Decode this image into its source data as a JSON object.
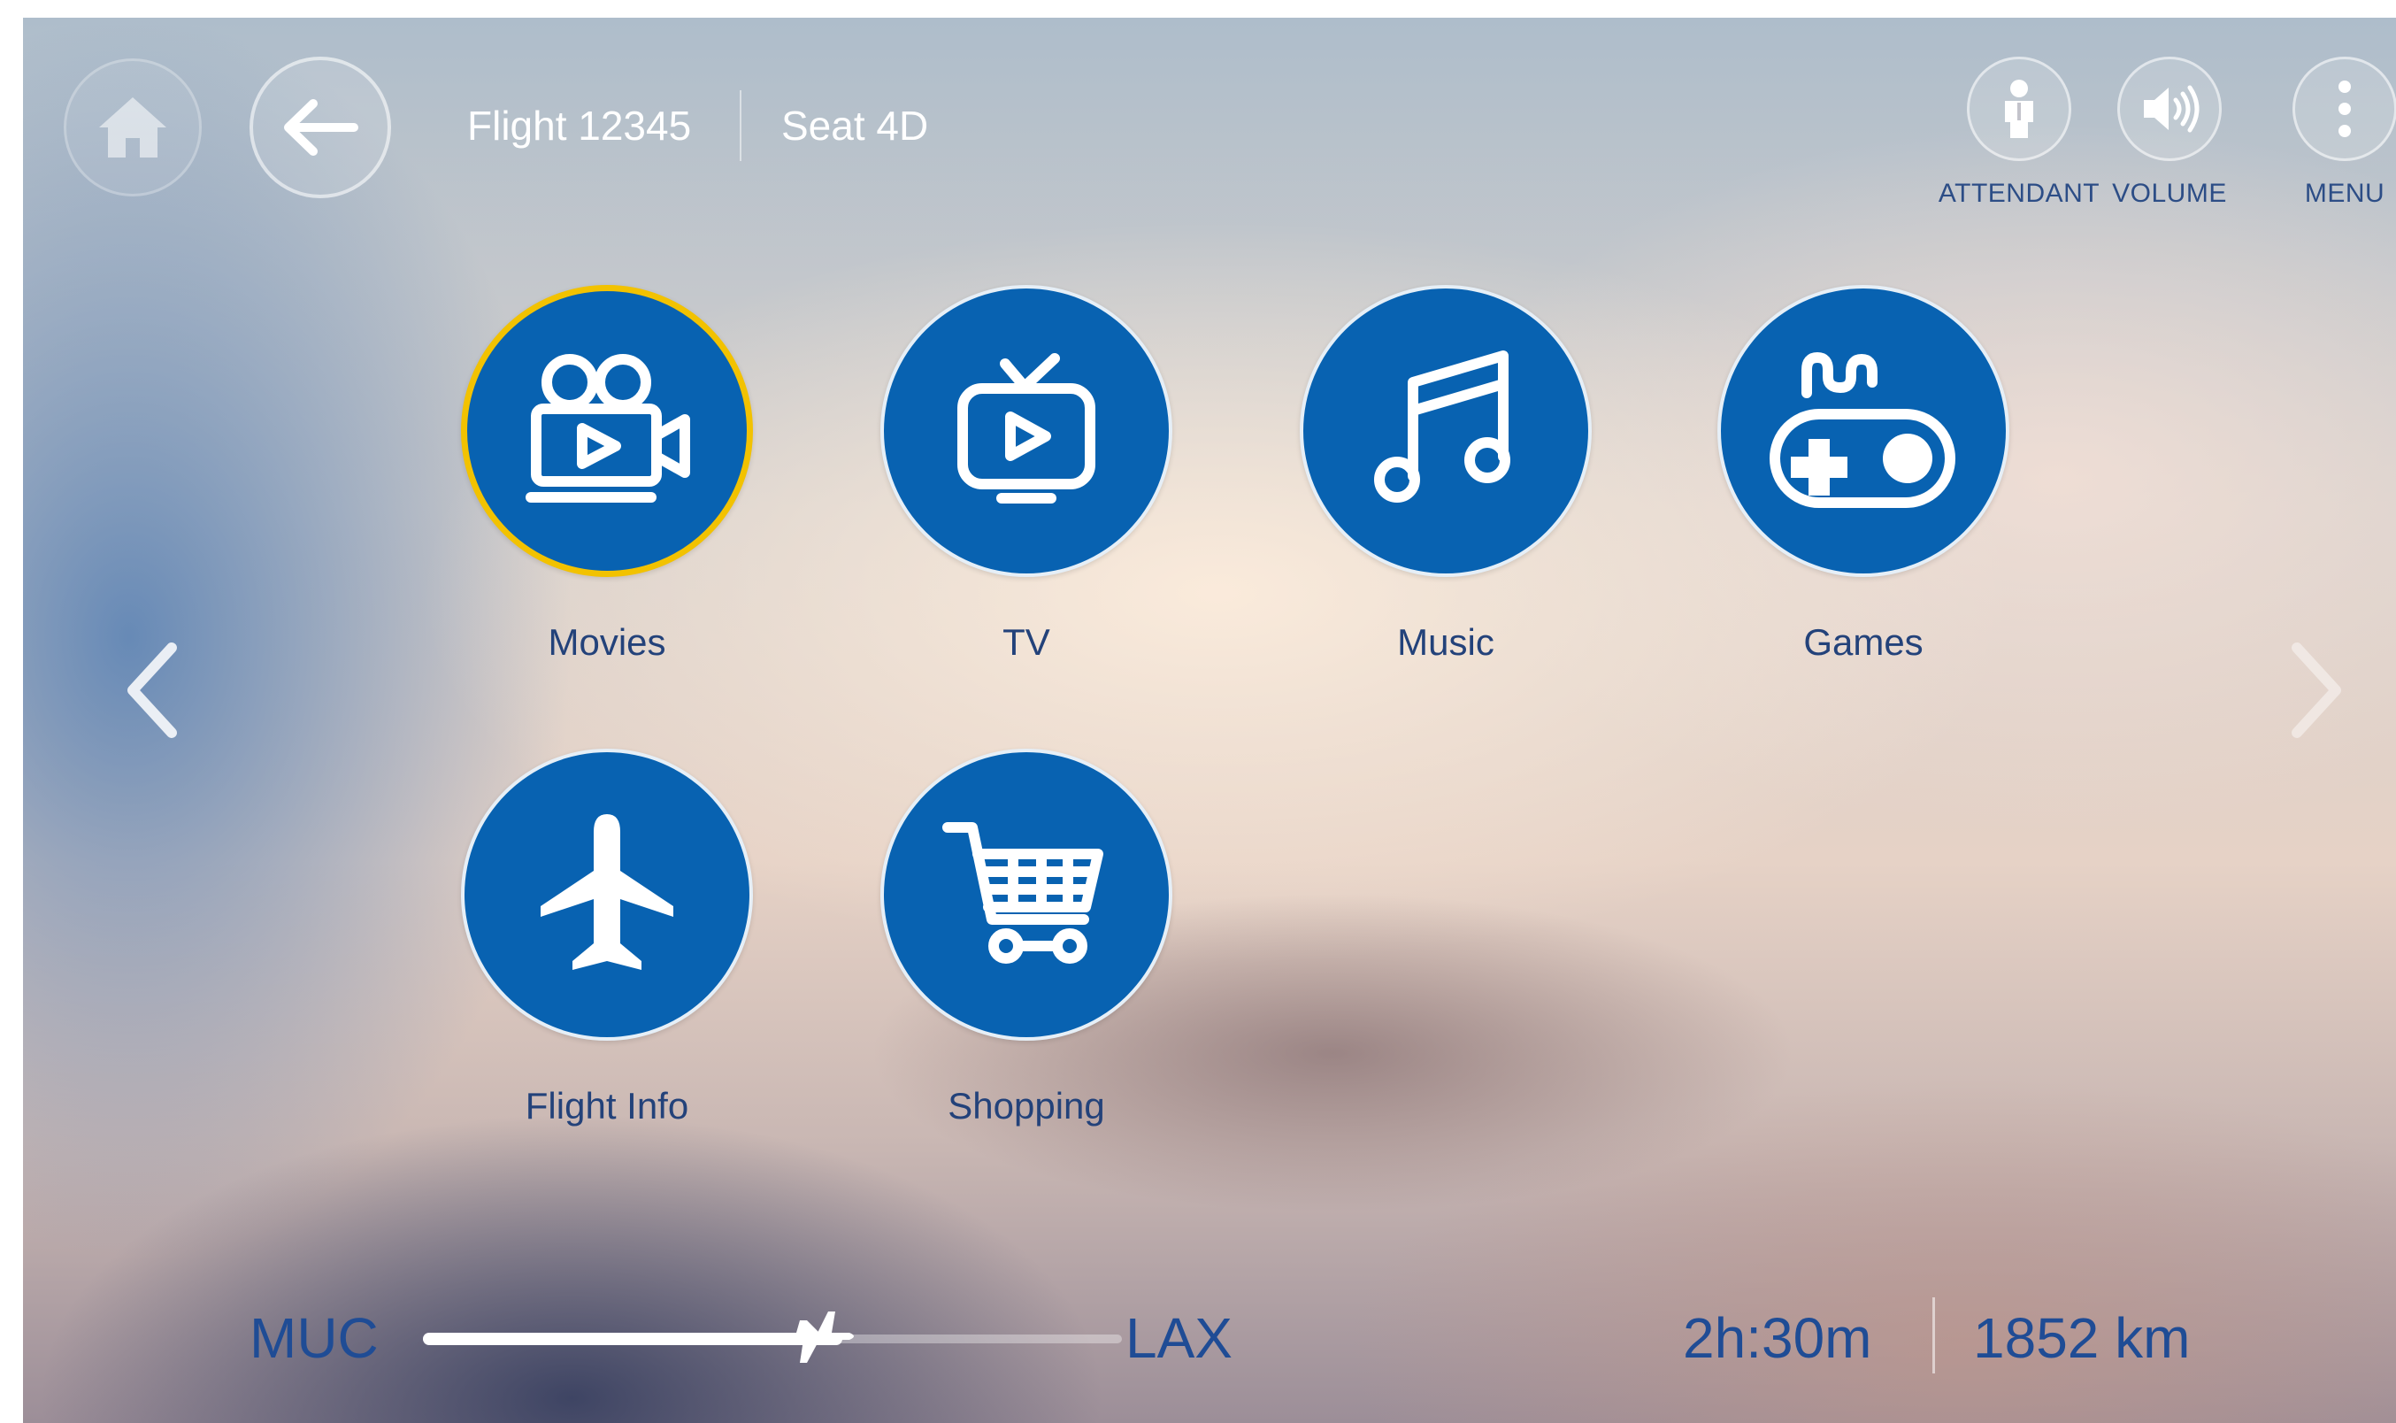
{
  "header": {
    "flight": "Flight 12345",
    "seat": "Seat 4D",
    "home_icon": "home-icon",
    "back_icon": "arrow-left-icon"
  },
  "tools": [
    {
      "label": "ATTENDANT",
      "icon": "attendant-icon"
    },
    {
      "label": "VOLUME",
      "icon": "speaker-icon"
    },
    {
      "label": "MENU",
      "icon": "more-vertical-icon"
    }
  ],
  "tiles": [
    {
      "label": "Movies",
      "icon": "movie-camera-icon",
      "selected": true
    },
    {
      "label": "TV",
      "icon": "tv-icon",
      "selected": false
    },
    {
      "label": "Music",
      "icon": "music-note-icon",
      "selected": false
    },
    {
      "label": "Games",
      "icon": "gamepad-icon",
      "selected": false
    },
    {
      "label": "Flight Info",
      "icon": "airplane-icon",
      "selected": false
    },
    {
      "label": "Shopping",
      "icon": "shopping-cart-icon",
      "selected": false
    }
  ],
  "route": {
    "origin": "MUC",
    "destination": "LAX",
    "progress": 0.6
  },
  "stats": {
    "time_remaining": "2h:30m",
    "distance": "1852 km"
  },
  "colors": {
    "tile_blue": "#0862b1",
    "selected_ring": "#f2c200",
    "text_blue": "#1f4c95",
    "label_blue": "#23427a"
  }
}
